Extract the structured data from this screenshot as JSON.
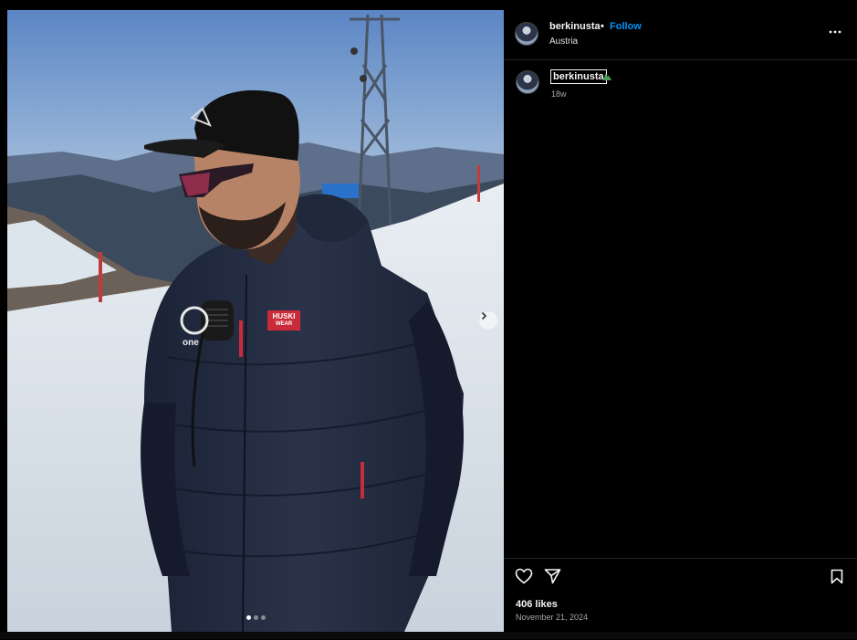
{
  "post": {
    "username": "berkinusta",
    "follow_label": "Follow",
    "separator": "•",
    "location": "Austria",
    "caption_user": "berkinusta",
    "caption_emoji": "mountain-icon",
    "time_ago": "18w",
    "likes": "406 likes",
    "date": "November 21, 2024"
  },
  "jacket": {
    "brand_top": "HUSKI",
    "brand_bottom": "WEAR",
    "patch_text": "one"
  },
  "carousel": {
    "total_slides": 3,
    "active_slide": 1
  },
  "icons": {
    "more": "more-options-icon",
    "like": "heart-icon",
    "share": "share-icon",
    "save": "bookmark-icon",
    "next": "chevron-right-icon"
  },
  "colors": {
    "follow": "#0095f6",
    "background": "#000000",
    "muted_text": "#a8a8a8"
  }
}
